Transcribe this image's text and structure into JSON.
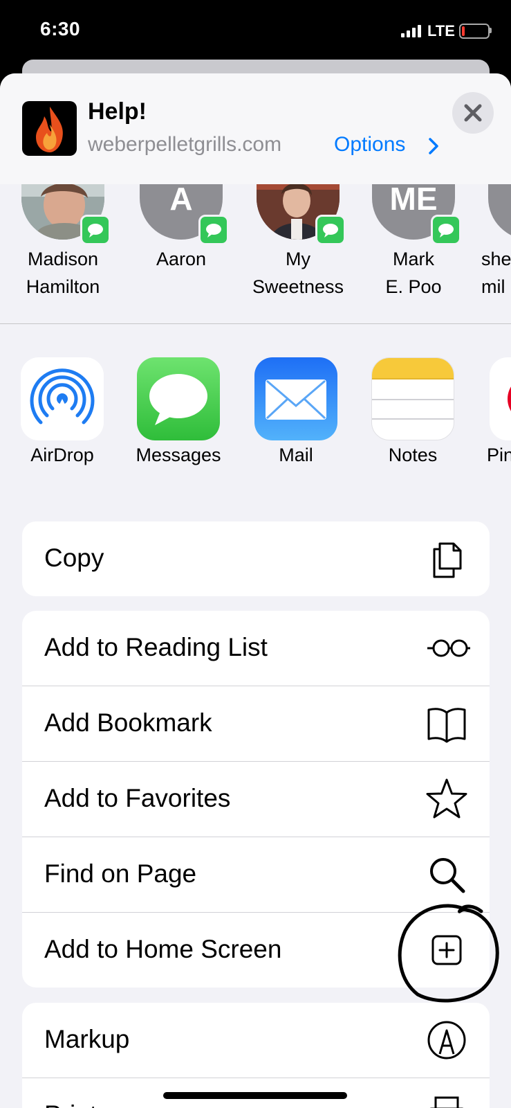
{
  "status_bar": {
    "time": "6:30",
    "network": "LTE"
  },
  "share_header": {
    "title": "Help!",
    "url": "weberpelletgrills.com",
    "options_label": "Options"
  },
  "people": [
    {
      "name_line1": "Madison",
      "name_line2": "Hamilton",
      "initials": ""
    },
    {
      "name_line1": "Aaron",
      "name_line2": "",
      "initials": "A"
    },
    {
      "name_line1": "My",
      "name_line2": "Sweetness",
      "initials": ""
    },
    {
      "name_line1": "Mark",
      "name_line2": "E. Poo",
      "initials": "ME"
    },
    {
      "name_line1": "she",
      "name_line2": "mil",
      "initials": ""
    }
  ],
  "apps": [
    {
      "label": "AirDrop",
      "icon": "airdrop-icon"
    },
    {
      "label": "Messages",
      "icon": "messages-icon"
    },
    {
      "label": "Mail",
      "icon": "mail-icon"
    },
    {
      "label": "Notes",
      "icon": "notes-icon"
    },
    {
      "label": "Pin",
      "icon": "pinterest-icon"
    }
  ],
  "actions_group1": [
    {
      "label": "Copy",
      "icon": "copy-icon"
    }
  ],
  "actions_group2": [
    {
      "label": "Add to Reading List",
      "icon": "glasses-icon"
    },
    {
      "label": "Add Bookmark",
      "icon": "book-icon"
    },
    {
      "label": "Add to Favorites",
      "icon": "star-icon"
    },
    {
      "label": "Find on Page",
      "icon": "search-icon"
    },
    {
      "label": "Add to Home Screen",
      "icon": "plus-square-icon"
    }
  ],
  "actions_group3": [
    {
      "label": "Markup",
      "icon": "markup-icon"
    },
    {
      "label": "Print",
      "icon": "printer-icon"
    }
  ],
  "colors": {
    "accent": "#007aff",
    "messages_green": "#34c759",
    "sheet_bg": "#f2f2f7"
  }
}
